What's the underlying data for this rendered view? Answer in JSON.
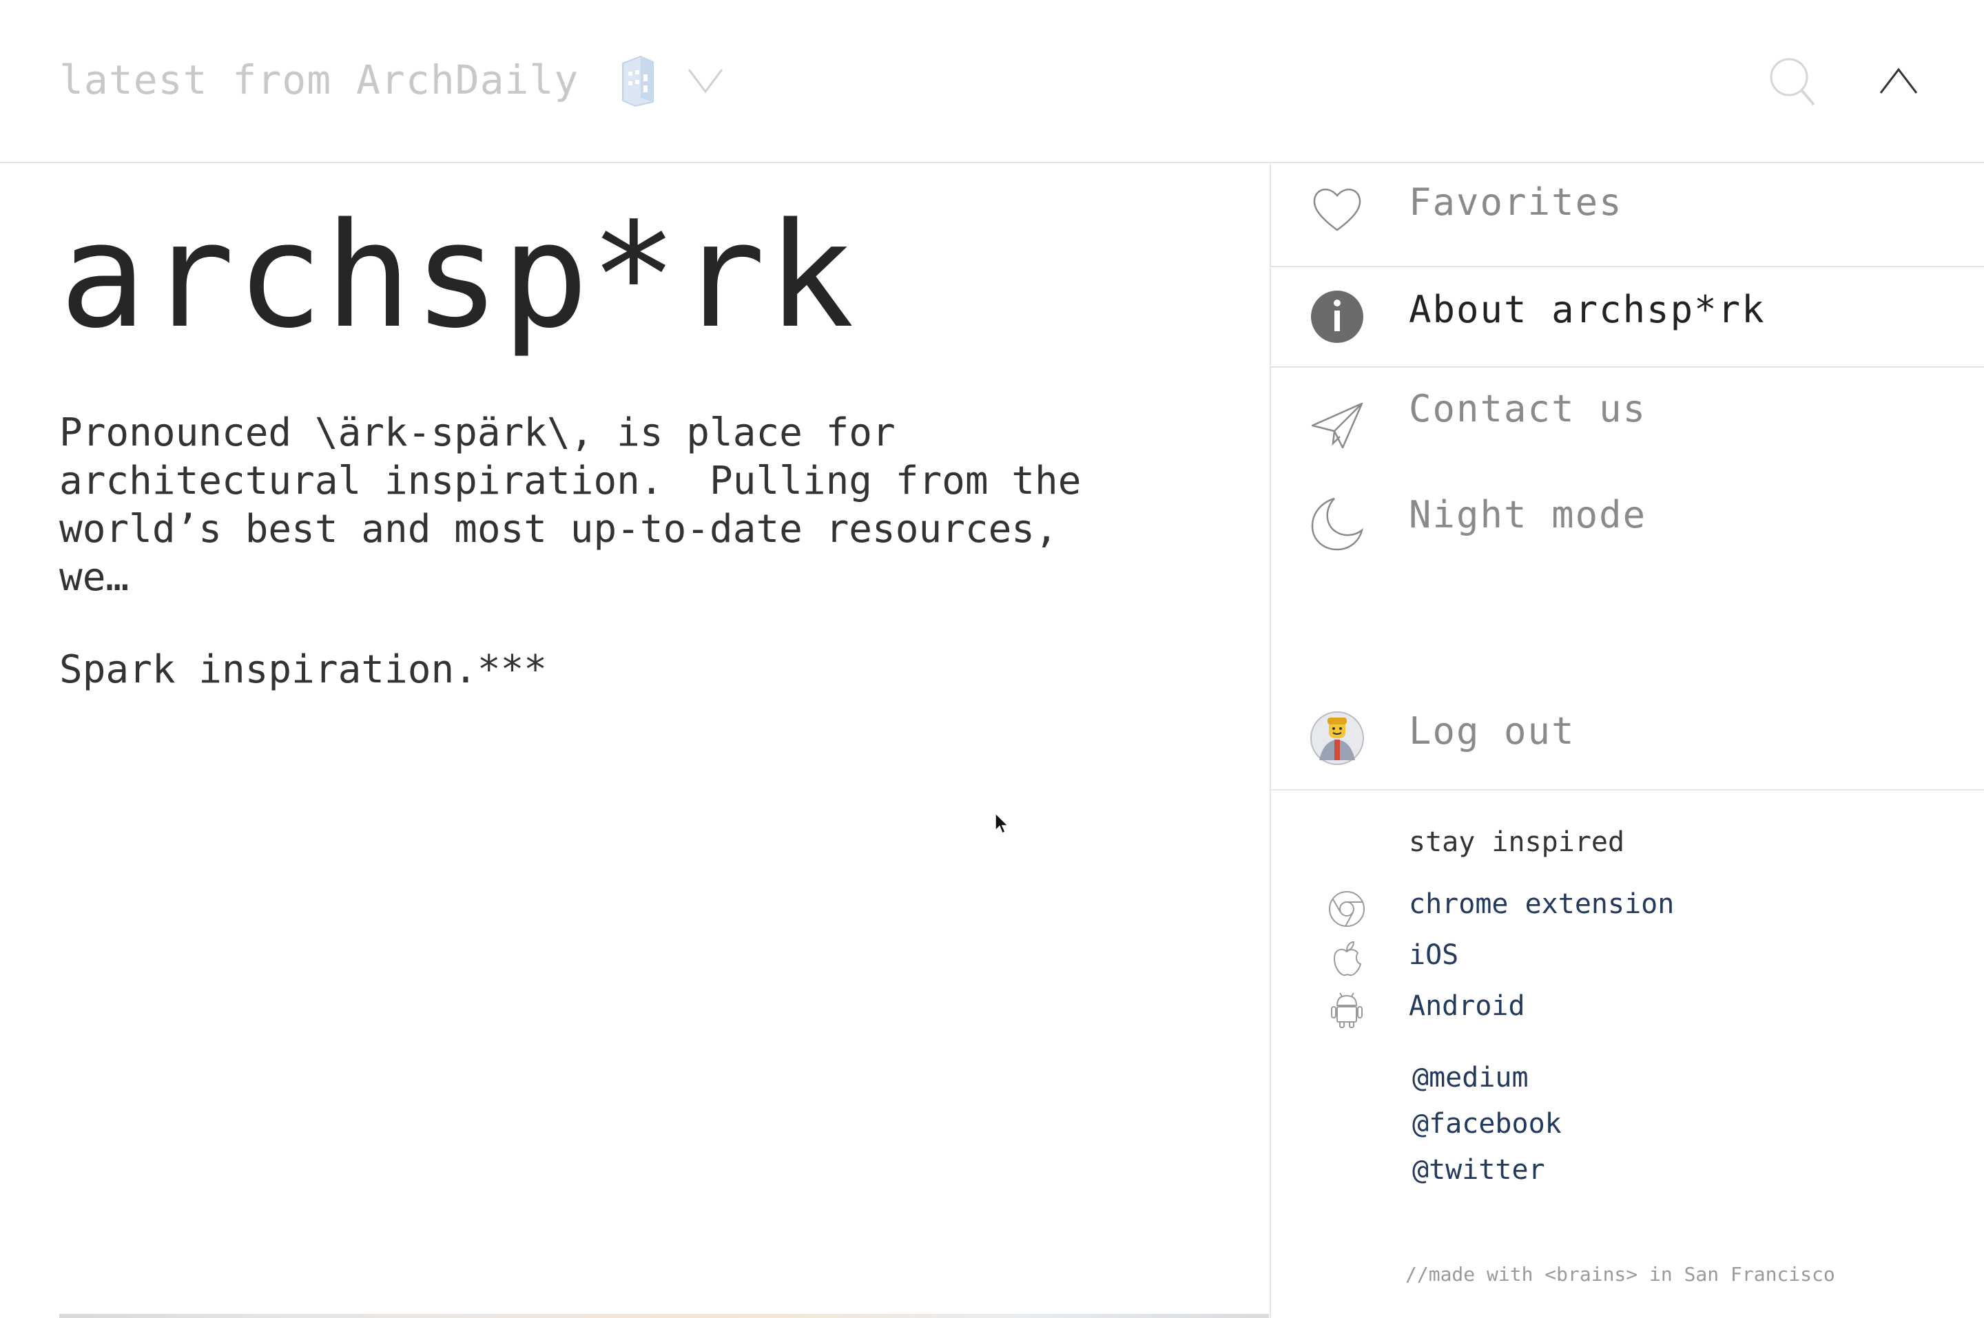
{
  "topbar": {
    "source_label": "latest from ArchDaily",
    "building_icon": "building-icon",
    "dropdown_icon": "chevron-down-icon",
    "search_icon": "search-icon",
    "collapse_icon": "chevron-up-icon"
  },
  "main": {
    "brand": "archsp*rk",
    "description": "Pronounced \\ärk-spärk\\, is place for\narchitectural inspiration.  Pulling from the\nworld’s best and most up-to-date resources,\nwe…",
    "tagline": "Spark inspiration.***"
  },
  "menu": {
    "items": [
      {
        "label": "Favorites",
        "icon": "heart-icon"
      },
      {
        "label": "About archsp*rk",
        "icon": "info-icon",
        "active": true
      },
      {
        "label": "Contact us",
        "icon": "paper-plane-icon"
      },
      {
        "label": "Night mode",
        "icon": "moon-icon"
      },
      {
        "label": "Log out",
        "icon": "avatar"
      }
    ]
  },
  "stay_inspired": {
    "title": "stay inspired",
    "apps": [
      {
        "label": "chrome extension",
        "icon": "chrome-icon"
      },
      {
        "label": "iOS",
        "icon": "apple-icon"
      },
      {
        "label": "Android",
        "icon": "android-icon"
      }
    ],
    "social": [
      "@medium",
      "@facebook",
      "@twitter"
    ]
  },
  "footer": {
    "note": "//made with <brains> in San Francisco"
  },
  "colors": {
    "link": "#23395d",
    "muted": "#8a8a8a",
    "text": "#262626",
    "info_circle": "#6b6b6b"
  }
}
